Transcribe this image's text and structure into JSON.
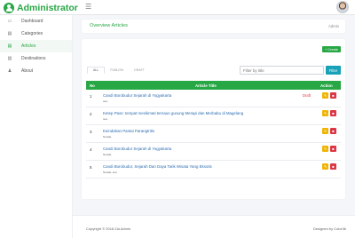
{
  "app": {
    "brand": "Administrator"
  },
  "sidebar": {
    "items": [
      {
        "label": "Dashboard",
        "icon": "dashboard-icon",
        "glyph": "▭"
      },
      {
        "label": "Categories",
        "icon": "categories-icon",
        "glyph": "▤"
      },
      {
        "label": "Articles",
        "icon": "articles-icon",
        "glyph": "▤"
      },
      {
        "label": "Destinations",
        "icon": "destinations-icon",
        "glyph": "▥"
      },
      {
        "label": "About",
        "icon": "about-icon",
        "glyph": "♟"
      }
    ],
    "active": "Articles"
  },
  "header": {
    "title": "Overview Articles",
    "breadcrumb": "Admin"
  },
  "toolbar": {
    "create_label": "+ Create",
    "tabs": [
      "ALL",
      "PUBLISH",
      "DRAFT"
    ],
    "search_placeholder": "Filter by title",
    "filter_label": "Filter"
  },
  "table": {
    "headers": {
      "no": "No",
      "title": "Article Title",
      "action": "Action"
    },
    "rows": [
      {
        "no": "1",
        "title": "Candi Borobudur Sejarah di Yogyakarta",
        "author": "test,",
        "status": "Draft"
      },
      {
        "no": "2",
        "title": "Ketep Pass: tempat menikmati ternaus gunung Merapi dan Merbabu di Magelang",
        "author": "test,",
        "status": ""
      },
      {
        "no": "3",
        "title": "Keindahan Pantai Parangtritis",
        "author": "Nowak,",
        "status": ""
      },
      {
        "no": "4",
        "title": "Candi Borobudur Sejarah di Yogyakarta",
        "author": "Nowak,",
        "status": ""
      },
      {
        "no": "5",
        "title": "Candi Borobudur, Sejarah Dan Daya Tarik Wisata Yang Eksotis",
        "author": "Nowak, test",
        "status": ""
      }
    ]
  },
  "footer": {
    "copyright": "Copyright © 2018 Zia Admin",
    "credit": "Designed by ColorlIb"
  },
  "colors": {
    "accent": "#28a745",
    "info": "#17a2b8",
    "warning": "#f0b400",
    "danger": "#dc3545"
  }
}
